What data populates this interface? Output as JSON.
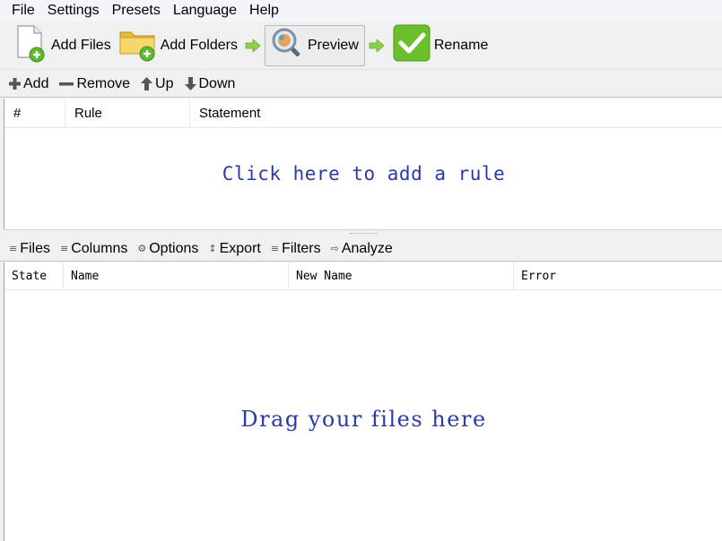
{
  "menu": [
    "File",
    "Settings",
    "Presets",
    "Language",
    "Help"
  ],
  "toolbar": {
    "add_files": "Add Files",
    "add_folders": "Add Folders",
    "preview": "Preview",
    "rename": "Rename"
  },
  "rules_toolbar": {
    "add": "Add",
    "remove": "Remove",
    "up": "Up",
    "down": "Down"
  },
  "rules_table": {
    "columns": [
      "#",
      "Rule",
      "Statement"
    ],
    "empty_text": "Click here to add a rule"
  },
  "files_toolbar": {
    "items": [
      {
        "label": "Files",
        "icon": "files-icon"
      },
      {
        "label": "Columns",
        "icon": "columns-icon"
      },
      {
        "label": "Options",
        "icon": "options-icon"
      },
      {
        "label": "Export",
        "icon": "export-icon"
      },
      {
        "label": "Filters",
        "icon": "filters-icon"
      },
      {
        "label": "Analyze",
        "icon": "analyze-icon"
      }
    ]
  },
  "files_table": {
    "columns": [
      "State",
      "Name",
      "New Name",
      "Error"
    ],
    "empty_text": "Drag your files here"
  },
  "colors": {
    "hint_text": "#2a3aa8",
    "rename_green": "#6cbf2a",
    "arrow_green": "#8ccf4a",
    "folder_yellow": "#f2cf5b"
  }
}
